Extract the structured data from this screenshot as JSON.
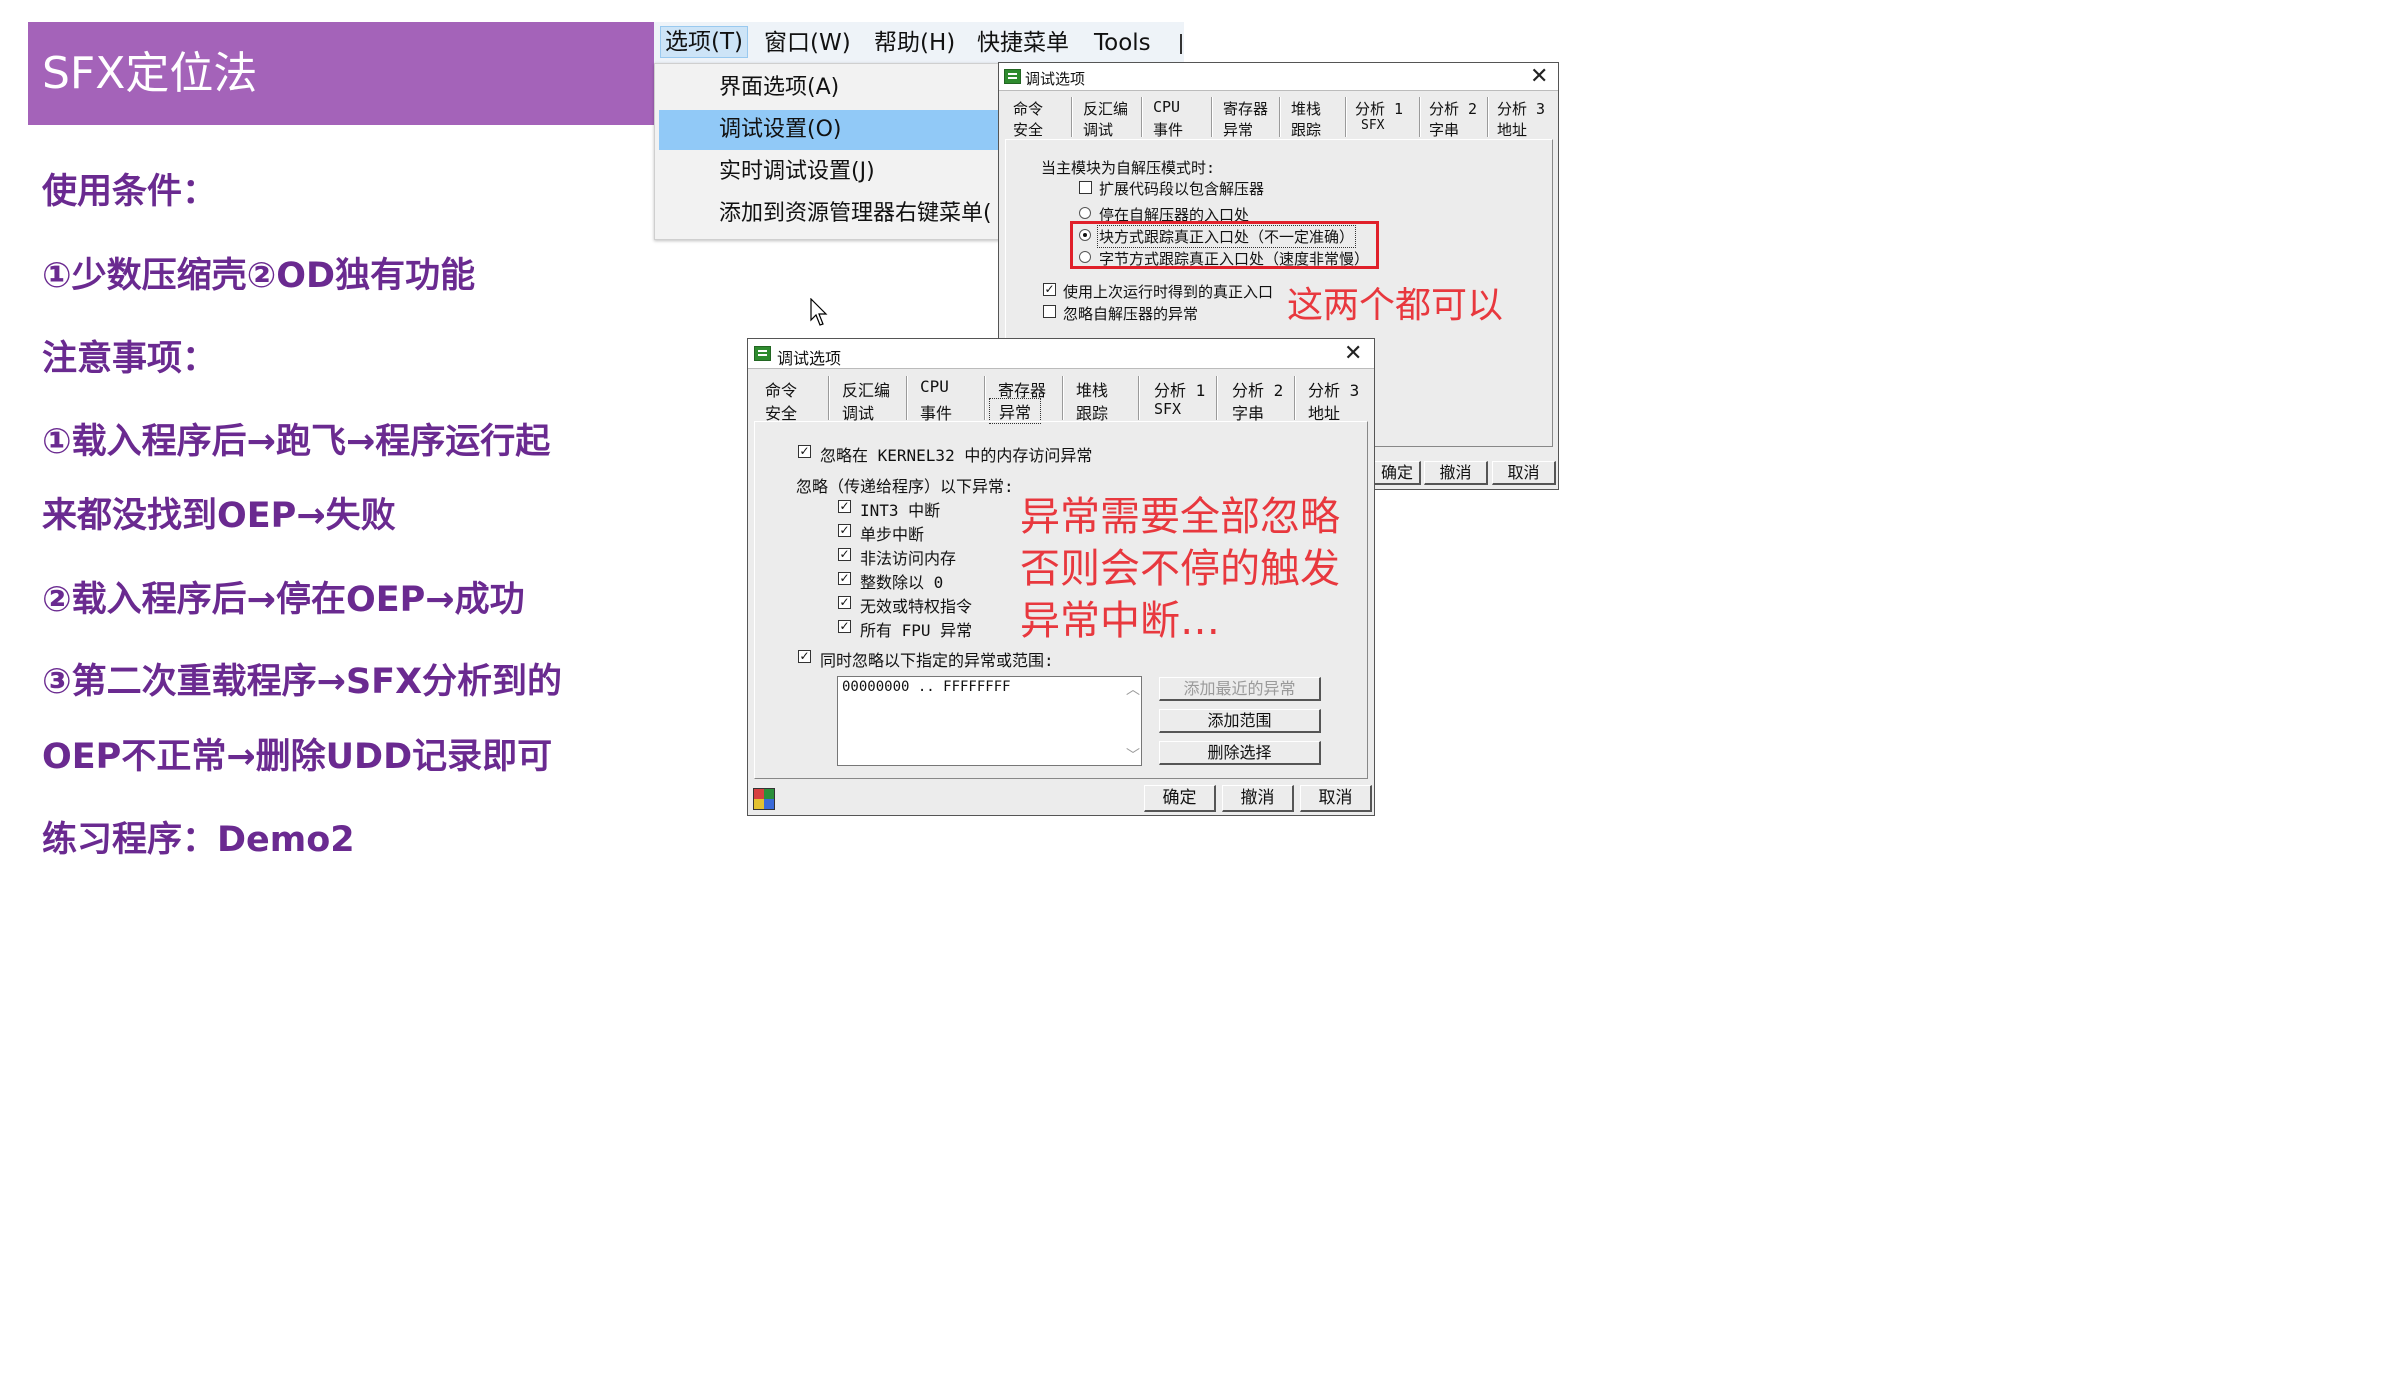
{
  "slide": {
    "title": "SFX定位法",
    "lines": [
      "使用条件：",
      "①少数压缩壳②OD独有功能",
      "注意事项：",
      "①载入程序后→跑飞→程序运行起",
      "来都没找到OEP→失败",
      "②载入程序后→停在OEP→成功",
      "③第二次重载程序→SFX分析到的",
      "OEP不正常→删除UDD记录即可",
      "练习程序：Demo2"
    ]
  },
  "menubar": {
    "items": [
      "选项(T)",
      "窗口(W)",
      "帮助(H)",
      "快捷菜单",
      "Tools"
    ]
  },
  "dropdown": {
    "items": [
      "界面选项(A)",
      "调试设置(O)",
      "实时调试设置(J)",
      "添加到资源管理器右键菜单("
    ]
  },
  "dialog_top": {
    "title": "调试选项",
    "close": "✕",
    "tabs_row1": [
      "命令",
      "反汇编",
      "CPU",
      "寄存器",
      "堆栈",
      "分析 1",
      "分析 2",
      "分析 3"
    ],
    "tabs_row2": [
      "安全",
      "调试",
      "事件",
      "异常",
      "跟踪",
      "SFX",
      "字串",
      "地址"
    ],
    "section_label": "当主模块为自解压模式时:",
    "extend_code": "扩展代码段以包含解压器",
    "radio_options": [
      "停在自解压器的入口处",
      "块方式跟踪真正入口处（不一定准确）",
      "字节方式跟踪真正入口处（速度非常慢）"
    ],
    "use_last_entry": "使用上次运行时得到的真正入口",
    "ignore_exceptions": "忽略自解压器的异常",
    "buttons": [
      "确定",
      "撤消",
      "取消"
    ]
  },
  "dialog_bottom": {
    "title": "调试选项",
    "close": "✕",
    "tabs_row1": [
      "命令",
      "反汇编",
      "CPU",
      "寄存器",
      "堆栈",
      "分析 1",
      "分析 2",
      "分析 3"
    ],
    "tabs_row2": [
      "安全",
      "调试",
      "事件",
      "异常",
      "跟踪",
      "SFX",
      "字串",
      "地址"
    ],
    "ignore_kernel32": "忽略在 KERNEL32 中的内存访问异常",
    "ignore_pass_label": "忽略（传递给程序）以下异常:",
    "exceptions": [
      "INT3 中断",
      "单步中断",
      "非法访问内存",
      "整数除以 0",
      "无效或特权指令",
      "所有 FPU 异常"
    ],
    "also_ignore": "同时忽略以下指定的异常或范围:",
    "range_value": "00000000 .. FFFFFFFF",
    "side_buttons": [
      "添加最近的异常",
      "添加范围",
      "删除选择"
    ],
    "buttons": [
      "确定",
      "撤消",
      "取消"
    ]
  },
  "annotations": {
    "both_ok": "这两个都可以",
    "exceptions_note": [
      "异常需要全部忽略",
      "否则会不停的触发",
      "异常中断…"
    ]
  }
}
